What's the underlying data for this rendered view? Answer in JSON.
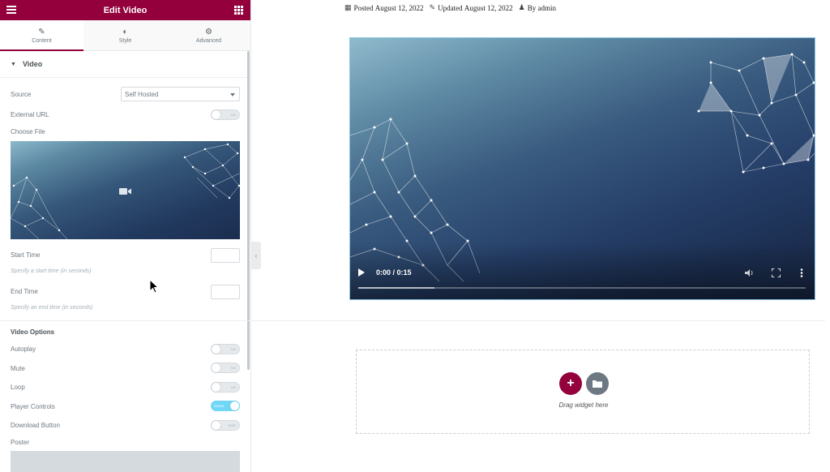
{
  "panel": {
    "title": "Edit Video",
    "tabs": [
      {
        "label": "Content",
        "icon": "pencil-icon",
        "active": true
      },
      {
        "label": "Style",
        "icon": "contrast-icon",
        "active": false
      },
      {
        "label": "Advanced",
        "icon": "gear-icon",
        "active": false
      }
    ],
    "section_title": "Video",
    "source": {
      "label": "Source",
      "value": "Self Hosted"
    },
    "external_url": {
      "label": "External URL",
      "state": "NO"
    },
    "choose_file": {
      "label": "Choose File"
    },
    "start_time": {
      "label": "Start Time",
      "description": "Specify a start time (in seconds)"
    },
    "end_time": {
      "label": "End Time",
      "description": "Specify an end time (in seconds)"
    },
    "video_options": {
      "title": "Video Options",
      "autoplay": {
        "label": "Autoplay",
        "state": "NO"
      },
      "mute": {
        "label": "Mute",
        "state": "NO"
      },
      "loop": {
        "label": "Loop",
        "state": "NO"
      },
      "player_controls": {
        "label": "Player Controls",
        "state": "SHOW"
      },
      "download_button": {
        "label": "Download Button",
        "state": "HIDE"
      },
      "poster": {
        "label": "Poster"
      }
    }
  },
  "preview": {
    "meta": {
      "posted_label": "Posted",
      "posted_date": "August 12, 2022",
      "updated_label": "Updated",
      "updated_date": "August 12, 2022",
      "by_label": "By",
      "author": "admin"
    },
    "video": {
      "time": "0:00 / 0:15",
      "buffered_fraction": 0.17
    },
    "dropzone": {
      "text": "Drag widget here"
    }
  },
  "colors": {
    "brand": "#93003c",
    "switch_on": "#71d7f7",
    "neutral": "#6d7882"
  }
}
